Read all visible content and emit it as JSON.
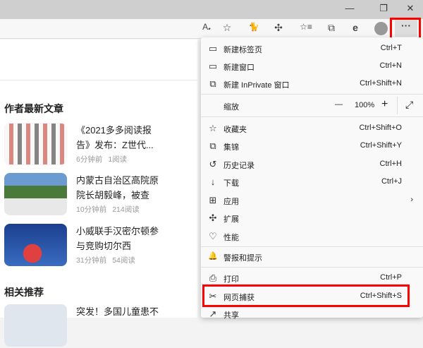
{
  "window_controls": {
    "minimize": "—",
    "restore": "❐",
    "close": "✕"
  },
  "toolbar": {
    "read_aloud": "A𝅘",
    "add_favorite": "☆",
    "extension_cat": "🐈",
    "extensions": "✣",
    "favorites": "☆≡",
    "collections": "⧉",
    "ie": "e",
    "more": "···"
  },
  "sections": {
    "author_latest": "作者最新文章",
    "related": "相关推荐"
  },
  "articles": [
    {
      "title": "《2021多多阅读报告》发布：Z世代...",
      "time": "6分钟前",
      "reads": "1阅读"
    },
    {
      "title": "内蒙古自治区高院原院长胡毅峰，被查",
      "time": "10分钟前",
      "reads": "214阅读"
    },
    {
      "title": "小威联手汉密尔顿参与竞购切尔西",
      "time": "31分钟前",
      "reads": "54阅读"
    },
    {
      "title": "突发！多国儿童患不"
    }
  ],
  "menu": {
    "items": [
      {
        "icon": "▭",
        "label": "新建标签页",
        "shortcut": "Ctrl+T"
      },
      {
        "icon": "▭",
        "label": "新建窗口",
        "shortcut": "Ctrl+N"
      },
      {
        "icon": "⧉",
        "label": "新建 InPrivate 窗口",
        "shortcut": "Ctrl+Shift+N"
      },
      {
        "icon": "☆",
        "label": "收藏夹",
        "shortcut": "Ctrl+Shift+O"
      },
      {
        "icon": "⧉",
        "label": "集锦",
        "shortcut": "Ctrl+Shift+Y"
      },
      {
        "icon": "↺",
        "label": "历史记录",
        "shortcut": "Ctrl+H"
      },
      {
        "icon": "↓",
        "label": "下载",
        "shortcut": "Ctrl+J"
      },
      {
        "icon": "⊞",
        "label": "应用",
        "shortcut": ""
      },
      {
        "icon": "✣",
        "label": "扩展",
        "shortcut": ""
      },
      {
        "icon": "♡",
        "label": "性能",
        "shortcut": ""
      },
      {
        "icon": "🔔",
        "label": "警报和提示",
        "shortcut": ""
      },
      {
        "icon": "⎙",
        "label": "打印",
        "shortcut": "Ctrl+P"
      },
      {
        "icon": "✂",
        "label": "网页捕获",
        "shortcut": "Ctrl+Shift+S"
      },
      {
        "icon": "↗",
        "label": "共享",
        "shortcut": ""
      }
    ],
    "zoom": {
      "label": "缩放",
      "minus": "—",
      "value": "100%",
      "plus": "+",
      "fullscreen": "⤢"
    }
  }
}
